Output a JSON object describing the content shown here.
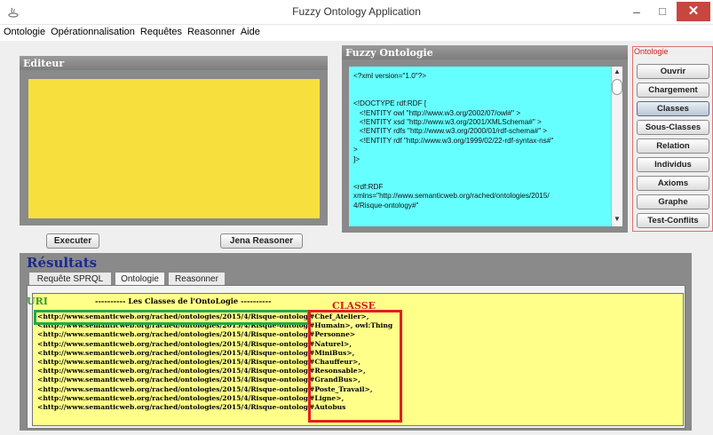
{
  "window": {
    "title": "Fuzzy Ontology Application",
    "minimize_glyph": "–",
    "maximize_glyph": "□",
    "close_glyph": "✕"
  },
  "menu": [
    "Ontologie",
    "Opérationnalisation",
    "Requêtes",
    "Reasonner",
    "Aide"
  ],
  "editor": {
    "title": "Editeur",
    "execute_button": "Executer",
    "jena_button": "Jena Reasoner"
  },
  "fuzzy": {
    "title": "Fuzzy Ontologie",
    "xml_text": "<?xml version=\"1.0\"?>\n\n\n<!DOCTYPE rdf:RDF [\n   <!ENTITY owl \"http://www.w3.org/2002/07/owl#\" >\n   <!ENTITY xsd \"http://www.w3.org/2001/XMLSchema#\" >\n   <!ENTITY rdfs \"http://www.w3.org/2000/01/rdf-schema#\" >\n   <!ENTITY rdf \"http://www.w3.org/1999/02/22-rdf-syntax-ns#\"\n>\n]>\n\n\n<rdf:RDF\nxmlns=\"http://www.semanticweb.org/rached/ontologies/2015/\n4/Risque-ontology#\""
  },
  "ontologie": {
    "label": "Ontologie",
    "buttons": [
      "Ouvrir",
      "Chargement",
      "Classes",
      "Sous-Classes",
      "Relation",
      "Individus",
      "Axioms",
      "Graphe",
      "Test-Conflits"
    ],
    "active": "Classes"
  },
  "results": {
    "title": "Résultats",
    "tabs": [
      "Requête SPRQL",
      "Ontologie",
      "Reasonner"
    ],
    "active_tab": "Ontologie",
    "uri_label": "URI",
    "classes_header": "---------- Les Classes de l'OntoLogie ----------",
    "classe_label": "CLASSE",
    "rows": [
      {
        "uri": "<http://www.semanticweb.org/rached/ontologies/2015/4/Risque-ontology",
        "cls": "#Chef_Atelier>,"
      },
      {
        "uri": "<http://www.semanticweb.org/rached/ontologies/2015/4/Risque-ontology",
        "cls": "#Humain>, owl:Thing"
      },
      {
        "uri": "<http://www.semanticweb.org/rached/ontologies/2015/4/Risque-ontology",
        "cls": "#Personne>"
      },
      {
        "uri": "<http://www.semanticweb.org/rached/ontologies/2015/4/Risque-ontology",
        "cls": "#Naturel>,"
      },
      {
        "uri": "<http://www.semanticweb.org/rached/ontologies/2015/4/Risque-ontology",
        "cls": "#MiniBus>,"
      },
      {
        "uri": "<http://www.semanticweb.org/rached/ontologies/2015/4/Risque-ontology",
        "cls": "#Chauffeur>,"
      },
      {
        "uri": "<http://www.semanticweb.org/rached/ontologies/2015/4/Risque-ontology",
        "cls": "#Resonsable>,"
      },
      {
        "uri": "<http://www.semanticweb.org/rached/ontologies/2015/4/Risque-ontology",
        "cls": "#GrandBus>,"
      },
      {
        "uri": "<http://www.semanticweb.org/rached/ontologies/2015/4/Risque-ontology",
        "cls": "#Poste_Travail>,"
      },
      {
        "uri": "<http://www.semanticweb.org/rached/ontologies/2015/4/Risque-ontology",
        "cls": "#Ligne>,"
      },
      {
        "uri": "<http://www.semanticweb.org/rached/ontologies/2015/4/Risque-ontology",
        "cls": "#Autobus"
      }
    ]
  },
  "colors": {
    "editor_bg": "#f7e03d",
    "xml_bg": "#66ffff",
    "results_bg": "#ffff8a",
    "uri_highlight": "#22a84a",
    "class_highlight": "#e02020"
  }
}
